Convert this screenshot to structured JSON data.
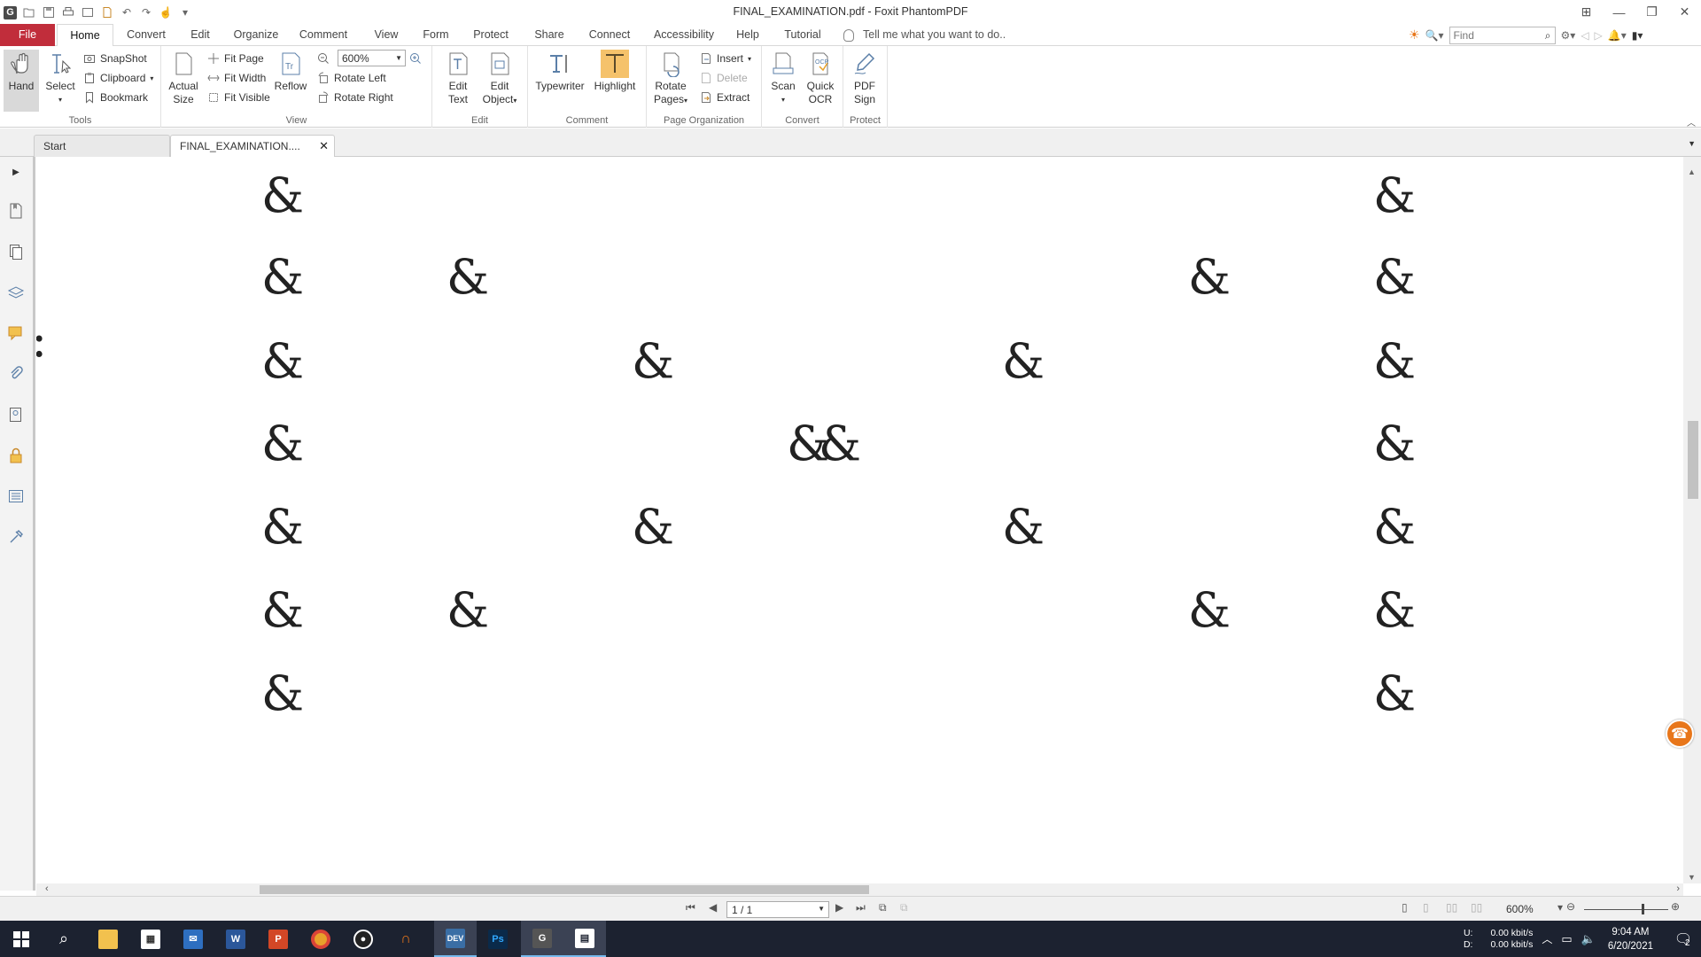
{
  "window": {
    "title": "FINAL_EXAMINATION.pdf - Foxit PhantomPDF"
  },
  "menu": {
    "file": "File",
    "home": "Home",
    "items": [
      "Convert",
      "Edit",
      "Organize",
      "Comment",
      "View",
      "Form",
      "Protect",
      "Share",
      "Connect",
      "Accessibility",
      "Help",
      "Tutorial"
    ],
    "tell_me": "Tell me what you want to do..",
    "find_placeholder": "Find"
  },
  "ribbon": {
    "tools": {
      "label": "Tools",
      "hand": "Hand",
      "select": "Select",
      "snapshot": "SnapShot",
      "clipboard": "Clipboard",
      "bookmark": "Bookmark"
    },
    "view": {
      "label": "View",
      "actual_size": [
        "Actual",
        "Size"
      ],
      "fit_page": "Fit Page",
      "fit_width": "Fit Width",
      "fit_visible": "Fit Visible",
      "reflow": "Reflow",
      "zoom": "600%",
      "rotate_left": "Rotate Left",
      "rotate_right": "Rotate Right"
    },
    "edit": {
      "label": "Edit",
      "edit_text": [
        "Edit",
        "Text"
      ],
      "edit_object": [
        "Edit",
        "Object"
      ]
    },
    "comment": {
      "label": "Comment",
      "typewriter": "Typewriter",
      "highlight": "Highlight"
    },
    "page_org": {
      "label": "Page Organization",
      "rotate_pages": [
        "Rotate",
        "Pages"
      ],
      "insert": "Insert",
      "delete": "Delete",
      "extract": "Extract"
    },
    "convert": {
      "label": "Convert",
      "scan": "Scan",
      "quick_ocr": [
        "Quick",
        "OCR"
      ]
    },
    "protect": {
      "label": "Protect",
      "pdf_sign": [
        "PDF",
        "Sign"
      ]
    }
  },
  "tabs": {
    "start": "Start",
    "doc": "FINAL_EXAMINATION...."
  },
  "document": {
    "glyph": "&",
    "partial_text": ":"
  },
  "status": {
    "page": "1 / 1",
    "zoom": "600%"
  },
  "tray": {
    "net_up_label": "U:",
    "net_down_label": "D:",
    "net_up": "0.00 kbit/s",
    "net_down": "0.00 kbit/s",
    "time": "9:04 AM",
    "date": "6/20/2021",
    "notifications": "2"
  },
  "taskbar": {
    "apps": [
      "file-explorer",
      "store",
      "mail",
      "word",
      "powerpoint",
      "chrome",
      "obs",
      "headset-app",
      "dev-cpp",
      "photoshop",
      "foxit-phantompdf",
      "window-app"
    ]
  }
}
